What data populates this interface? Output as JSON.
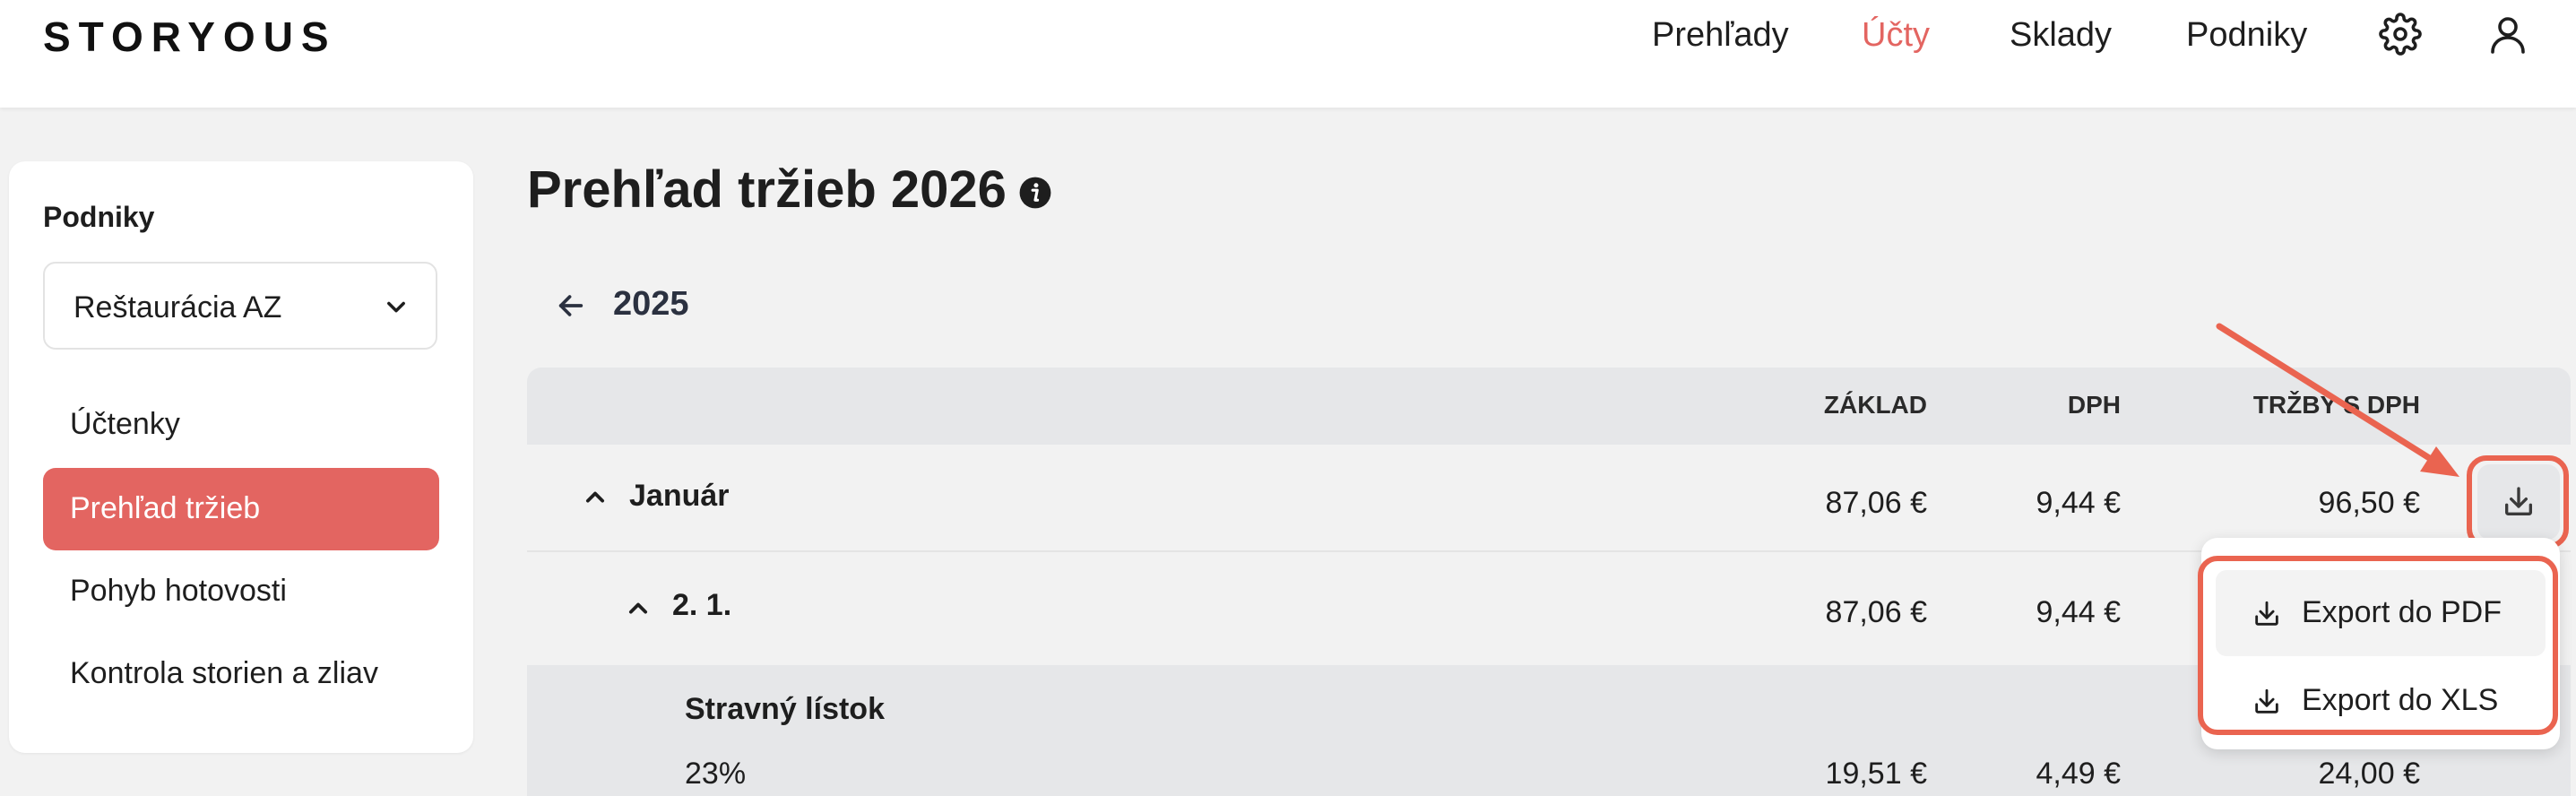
{
  "brand": {
    "logo": "STORYOUS"
  },
  "nav": {
    "items": [
      {
        "label": "Prehľady"
      },
      {
        "label": "Účty"
      },
      {
        "label": "Sklady"
      },
      {
        "label": "Podniky"
      }
    ],
    "settings_icon": "gear-icon",
    "user_icon": "user-icon"
  },
  "sidebar": {
    "heading": "Podniky",
    "select_value": "Reštaurácia AZ",
    "items": [
      {
        "label": "Účtenky"
      },
      {
        "label": "Prehľad tržieb"
      },
      {
        "label": "Pohyb hotovosti"
      },
      {
        "label": "Kontrola storien a zliav"
      }
    ]
  },
  "main": {
    "title": "Prehľad tržieb 2026",
    "info_icon": "info-icon",
    "year_back_label": "2025",
    "table": {
      "headers": [
        "ZÁKLAD",
        "DPH",
        "TRŽBY S DPH"
      ],
      "rows": [
        {
          "label": "Január",
          "zaklad": "87,06 €",
          "dph": "9,44 €",
          "trzby": "96,50 €"
        },
        {
          "label": "2. 1.",
          "zaklad": "87,06 €",
          "dph": "9,44 €",
          "trzby": ""
        },
        {
          "label": "Stravný lístok",
          "sub_label": "23%",
          "zaklad": "19,51 €",
          "dph": "4,49 €",
          "trzby": "24,00 €"
        }
      ]
    },
    "export_menu": {
      "items": [
        {
          "label": "Export do PDF"
        },
        {
          "label": "Export do XLS"
        }
      ]
    }
  },
  "colors": {
    "accent": "#e36561",
    "annotation": "#ea6450",
    "header_bg": "#e6e7e9",
    "page_bg": "#f2f2f2"
  }
}
